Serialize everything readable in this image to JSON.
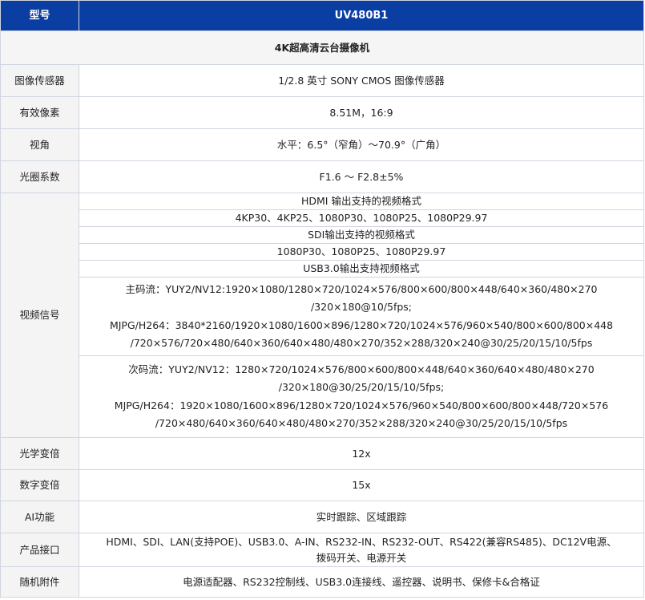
{
  "header": {
    "col1": "型号",
    "col2": "UV480B1"
  },
  "title": "4K超高清云台摄像机",
  "rows": {
    "sensor": {
      "label": "图像传感器",
      "value": "1/2.8 英寸 SONY CMOS 图像传感器"
    },
    "pixels": {
      "label": "有效像素",
      "value": "8.51M，16:9"
    },
    "fov": {
      "label": "视角",
      "value": "水平：6.5°（窄角）～70.9°（广角）"
    },
    "aperture": {
      "label": "光圈系数",
      "value": "F1.6 ～ F2.8±5%"
    },
    "video": {
      "label": "视频信号",
      "hdmi_title": "HDMI 输出支持的视频格式",
      "hdmi_formats": "4KP30、4KP25、1080P30、1080P25、1080P29.97",
      "sdi_title": "SDI输出支持的视频格式",
      "sdi_formats": "1080P30、1080P25、1080P29.97",
      "usb_title": "USB3.0输出支持视频格式",
      "main_stream": [
        "主码流：YUY2/NV12:1920×1080/1280×720/1024×576/800×600/800×448/640×360/480×270",
        "/320×180@10/5fps;",
        "MJPG/H264：3840*2160/1920×1080/1600×896/1280×720/1024×576/960×540/800×600/800×448",
        "/720×576/720×480/640×360/640×480/480×270/352×288/320×240@30/25/20/15/10/5fps"
      ],
      "sub_stream": [
        "次码流：YUY2/NV12：1280×720/1024×576/800×600/800×448/640×360/640×480/480×270",
        "/320×180@30/25/20/15/10/5fps;",
        "MJPG/H264：1920×1080/1600×896/1280×720/1024×576/960×540/800×600/800×448/720×576",
        "/720×480/640×360/640×480/480×270/352×288/320×240@30/25/20/15/10/5fps"
      ]
    },
    "optical_zoom": {
      "label": "光学变倍",
      "value": "12x"
    },
    "digital_zoom": {
      "label": "数字变倍",
      "value": "15x"
    },
    "ai": {
      "label": "AI功能",
      "value": "实时跟踪、区域跟踪"
    },
    "ports": {
      "label": "产品接口",
      "value": [
        "HDMI、SDI、LAN(支持POE)、USB3.0、A-IN、RS232-IN、RS232-OUT、RS422(兼容RS485)、DC12V电源、",
        "拨码开关、电源开关"
      ]
    },
    "accessories": {
      "label": "随机附件",
      "value": "电源适配器、RS232控制线、USB3.0连接线、遥控器、说明书、保修卡&合格证"
    }
  }
}
